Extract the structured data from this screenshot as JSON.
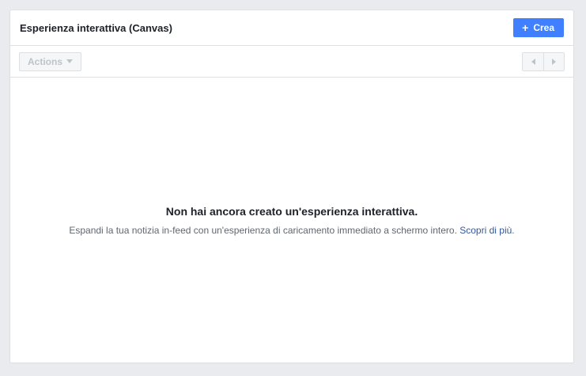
{
  "header": {
    "title": "Esperienza interattiva (Canvas)",
    "create_label": "Crea"
  },
  "toolbar": {
    "actions_label": "Actions"
  },
  "empty_state": {
    "title": "Non hai ancora creato un'esperienza interattiva.",
    "description": "Espandi la tua notizia in-feed con un'esperienza di caricamento immediato a schermo intero.",
    "link_text": "Scopri di più",
    "trailing": "."
  },
  "colors": {
    "primary": "#4080ff",
    "link": "#365899",
    "background": "#e9ebee"
  },
  "icons": {
    "create": "plus-icon",
    "actions": "caret-down-icon",
    "prev": "chevron-left-icon",
    "next": "chevron-right-icon"
  }
}
